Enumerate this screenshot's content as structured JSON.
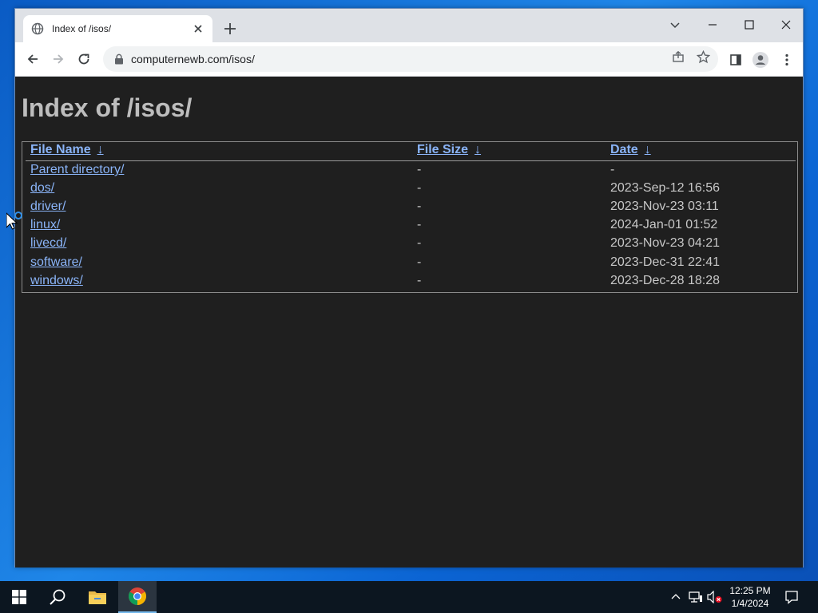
{
  "browser": {
    "tab_title": "Index of /isos/",
    "url": "computernewb.com/isos/"
  },
  "page": {
    "heading": "Index of /isos/",
    "columns": {
      "name": "File Name",
      "size": "File Size",
      "date": "Date",
      "sort_arrow": "↓"
    },
    "rows": [
      {
        "name": "Parent directory/",
        "size": "-",
        "date": "-"
      },
      {
        "name": "dos/",
        "size": "-",
        "date": "2023-Sep-12 16:56"
      },
      {
        "name": "driver/",
        "size": "-",
        "date": "2023-Nov-23 03:11"
      },
      {
        "name": "linux/",
        "size": "-",
        "date": "2024-Jan-01 01:52"
      },
      {
        "name": "livecd/",
        "size": "-",
        "date": "2023-Nov-23 04:21"
      },
      {
        "name": "software/",
        "size": "-",
        "date": "2023-Dec-31 22:41"
      },
      {
        "name": "windows/",
        "size": "-",
        "date": "2023-Dec-28 18:28"
      }
    ]
  },
  "taskbar": {
    "time": "12:25 PM",
    "date": "1/4/2024"
  },
  "colors": {
    "link": "#8ab4f8",
    "page_bg": "#1f1f1f",
    "taskbar_bg": "#0c1620"
  }
}
